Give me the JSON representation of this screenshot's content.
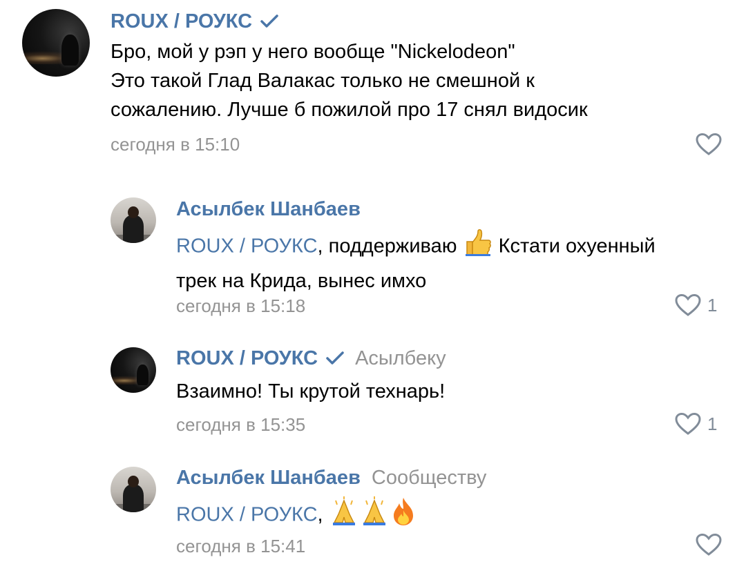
{
  "comments": [
    {
      "author": "ROUX / РОУКС",
      "verified": true,
      "reply_to": "",
      "lines": [
        "Бро, мой у рэп у него вообще \"Nickelodeon\"",
        "Это такой Глад Валакас только не смешной к",
        "сожалению. Лучше б пожилой про 17 снял видосик"
      ],
      "time": "сегодня в 15:10",
      "likes": ""
    },
    {
      "author": "Асылбек Шанбаев",
      "verified": false,
      "reply_to": "",
      "mention": "ROUX / РОУКС",
      "line1_rest": ", поддерживаю",
      "line1_after_emoji": " Кстати охуенный",
      "line2": "трек на Крида, вынес имхо",
      "emoji": "thumbs-up-emoji",
      "time": "сегодня в 15:18",
      "likes": "1"
    },
    {
      "author": "ROUX / РОУКС",
      "verified": true,
      "reply_to": "Асылбеку",
      "line": "Взаимно! Ты крутой технарь!",
      "time": "сегодня в 15:35",
      "likes": "1"
    },
    {
      "author": "Асылбек Шанбаев",
      "verified": false,
      "reply_to": "Сообществу",
      "mention": "ROUX / РОУКС",
      "line_rest": ",",
      "emojis": [
        "folded-hands-emoji",
        "folded-hands-emoji",
        "fire-emoji"
      ],
      "time": "сегодня в 15:41",
      "likes": ""
    }
  ],
  "colors": {
    "link": "#4a76a8",
    "meta": "#939393",
    "text": "#000000",
    "icon": "#818c99"
  }
}
